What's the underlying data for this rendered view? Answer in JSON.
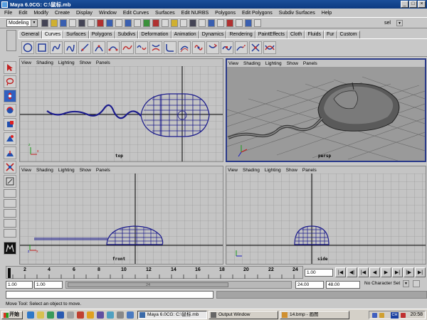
{
  "window": {
    "title": "Maya 6.0CG: C:\\鼠标.mb"
  },
  "menus": [
    "File",
    "Edit",
    "Modify",
    "Create",
    "Display",
    "Window",
    "Edit Curves",
    "Surfaces",
    "Edit NURBS",
    "Polygons",
    "Edit Polygons",
    "Subdiv Surfaces",
    "Help"
  ],
  "statusline": {
    "mode": "Modeling",
    "sel_label": "sel"
  },
  "shelf": {
    "tabs": [
      "General",
      "Curves",
      "Surfaces",
      "Polygons",
      "Subdivs",
      "Deformation",
      "Animation",
      "Dynamics",
      "Rendering",
      "PaintEffects",
      "Cloth",
      "Fluids",
      "Fur",
      "Custom"
    ],
    "active_tab": "Curves",
    "icons": [
      "circle-curve-icon",
      "square-curve-icon",
      "cv-curve-icon",
      "ep-curve-icon",
      "pencil-curve-icon",
      "arc-icon",
      "arc-2pt-icon",
      "attach-curve-icon",
      "detach-curve-icon",
      "align-curve-icon",
      "fillet-curve-icon",
      "offset-curve-icon",
      "rebuild-curve-icon",
      "reverse-curve-icon",
      "insert-knot-icon",
      "extend-curve-icon",
      "cut-curve-icon",
      "intersect-curve-icon"
    ]
  },
  "viewport_menu": [
    "View",
    "Shading",
    "Lighting",
    "Show",
    "Panels"
  ],
  "viewports": {
    "top": {
      "label": "top"
    },
    "persp": {
      "label": "persp"
    },
    "front": {
      "label": "front"
    },
    "side": {
      "label": "side"
    }
  },
  "timeslider": {
    "ticks": [
      "2",
      "4",
      "6",
      "8",
      "10",
      "12",
      "14",
      "16",
      "18",
      "20",
      "22",
      "24"
    ],
    "current_time": "1.00"
  },
  "range": {
    "start_time": "1.00",
    "playback_start": "1.00",
    "playback_end": "24.00",
    "end_time": "48.00",
    "slider_label": "24",
    "character_set": "No Character Set"
  },
  "help_line": "Move Tool: Select an object to move.",
  "taskbar": {
    "start": "开始",
    "tasks": [
      {
        "label": "Maya 6.0CG: C:\\鼠标.mb",
        "active": true
      },
      {
        "label": "Output Window",
        "active": false
      },
      {
        "label": "14.bmp - 画图",
        "active": false
      }
    ],
    "ime": "CH",
    "clock": "20:58"
  },
  "colors": {
    "viewport_bg": "#c4c4c4",
    "wireframe": "#1b1b8c",
    "active_border": "#2a3a8a",
    "persp_bg": "#9a9a9a"
  }
}
